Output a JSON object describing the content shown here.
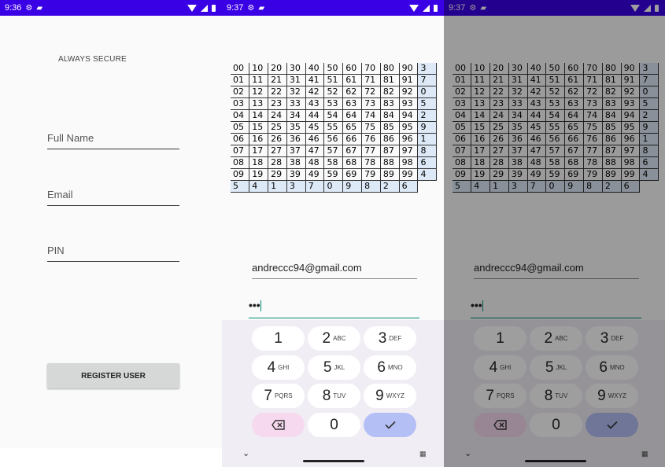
{
  "screens": [
    {
      "status_time": "9:36"
    },
    {
      "status_time": "9:37"
    },
    {
      "status_time": "9:37"
    }
  ],
  "register": {
    "secure_label": "ALWAYS SECURE",
    "full_name_hint": "Full Name",
    "email_hint": "Email",
    "pin_hint": "PIN",
    "button_label": "REGISTER USER"
  },
  "login": {
    "email_value": "andreccc94@gmail.com",
    "pin_value": "•••"
  },
  "grid": {
    "rows": [
      [
        "00",
        "10",
        "20",
        "30",
        "40",
        "50",
        "60",
        "70",
        "80",
        "90",
        "3"
      ],
      [
        "01",
        "11",
        "21",
        "31",
        "41",
        "51",
        "61",
        "71",
        "81",
        "91",
        "7"
      ],
      [
        "02",
        "12",
        "22",
        "32",
        "42",
        "52",
        "62",
        "72",
        "82",
        "92",
        "0"
      ],
      [
        "03",
        "13",
        "23",
        "33",
        "43",
        "53",
        "63",
        "73",
        "83",
        "93",
        "5"
      ],
      [
        "04",
        "14",
        "24",
        "34",
        "44",
        "54",
        "64",
        "74",
        "84",
        "94",
        "2"
      ],
      [
        "05",
        "15",
        "25",
        "35",
        "45",
        "55",
        "65",
        "75",
        "85",
        "95",
        "9"
      ],
      [
        "06",
        "16",
        "26",
        "36",
        "46",
        "56",
        "66",
        "76",
        "86",
        "96",
        "1"
      ],
      [
        "07",
        "17",
        "27",
        "37",
        "47",
        "57",
        "67",
        "77",
        "87",
        "97",
        "8"
      ],
      [
        "08",
        "18",
        "28",
        "38",
        "48",
        "58",
        "68",
        "78",
        "88",
        "98",
        "6"
      ],
      [
        "09",
        "19",
        "29",
        "39",
        "49",
        "59",
        "69",
        "79",
        "89",
        "99",
        "4"
      ]
    ],
    "bottom_row": [
      "5",
      "4",
      "1",
      "3",
      "7",
      "0",
      "9",
      "8",
      "2",
      "6"
    ]
  },
  "keyboard": {
    "keys": [
      {
        "digit": "1",
        "letters": ""
      },
      {
        "digit": "2",
        "letters": "ABC"
      },
      {
        "digit": "3",
        "letters": "DEF"
      },
      {
        "digit": "4",
        "letters": "GHI"
      },
      {
        "digit": "5",
        "letters": "JKL"
      },
      {
        "digit": "6",
        "letters": "MNO"
      },
      {
        "digit": "7",
        "letters": "PQRS"
      },
      {
        "digit": "8",
        "letters": "TUV"
      },
      {
        "digit": "9",
        "letters": "WXYZ"
      },
      {
        "digit": "0",
        "letters": ""
      }
    ],
    "delete_icon": "backspace-icon",
    "done_icon": "check-icon",
    "collapse_icon": "chevron-down-icon",
    "switch_icon": "keyboard-icon"
  },
  "colors": {
    "status_bar": "#3a00e5",
    "accent_teal": "#00897b",
    "grid_highlight": "#dde9f7",
    "delete_key": "#f6d9ef",
    "done_key": "#b4bff5"
  }
}
